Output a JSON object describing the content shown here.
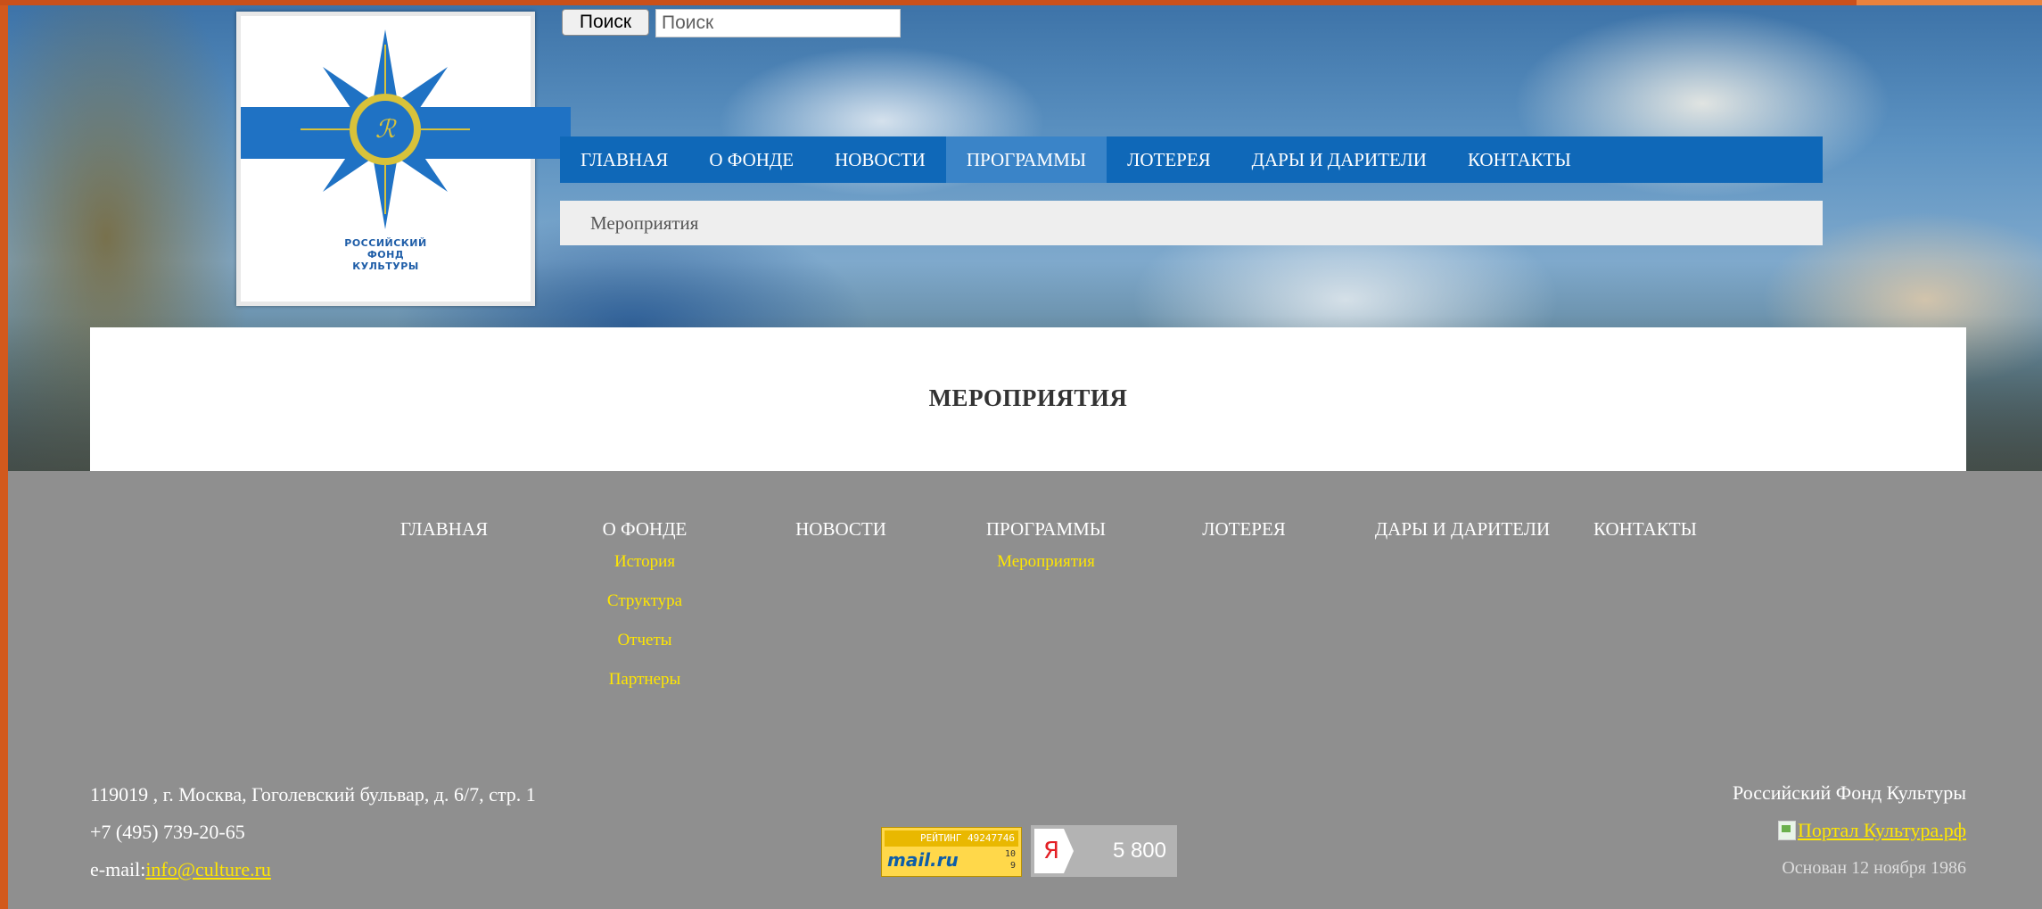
{
  "search": {
    "button_label": "Поиск",
    "placeholder": "Поиск"
  },
  "logo": {
    "lines": [
      "РОССИЙСКИЙ",
      "ФОНД",
      "КУЛЬТУРЫ"
    ]
  },
  "main_nav": [
    {
      "label": "ГЛАВНАЯ",
      "active": false
    },
    {
      "label": "О ФОНДЕ",
      "active": false
    },
    {
      "label": "НОВОСТИ",
      "active": false
    },
    {
      "label": "ПРОГРАММЫ",
      "active": true
    },
    {
      "label": "ЛОТЕРЕЯ",
      "active": false
    },
    {
      "label": "ДАРЫ И ДАРИТЕЛИ",
      "active": false
    },
    {
      "label": "КОНТАКТЫ",
      "active": false
    }
  ],
  "breadcrumb": "Мероприятия",
  "page_title": "МЕРОПРИЯТИЯ",
  "footer_nav": [
    {
      "label": "ГЛАВНАЯ",
      "sub": []
    },
    {
      "label": "О ФОНДЕ",
      "sub": [
        "История",
        "Структура",
        "Отчеты",
        "Партнеры"
      ]
    },
    {
      "label": "НОВОСТИ",
      "sub": []
    },
    {
      "label": "ПРОГРАММЫ",
      "sub": [
        "Мероприятия"
      ]
    },
    {
      "label": "ЛОТЕРЕЯ",
      "sub": []
    },
    {
      "label": "ДАРЫ И ДАРИТЕЛИ",
      "sub": []
    },
    {
      "label": "КОНТАКТЫ",
      "sub": []
    }
  ],
  "contacts": {
    "address": "119019 , г. Москва, Гоголевский бульвар, д. 6/7, стр. 1",
    "phone": "+7 (495) 739-20-65",
    "email_label": "e-mail:",
    "email": "info@culture.ru"
  },
  "counters": {
    "mail_top": "РЕЙТИНГ 49247746",
    "mail_brand": "mail.ru",
    "mail_num_1": "10",
    "mail_num_2": "9",
    "yandex_letter": "Я",
    "yandex_count": "5 800"
  },
  "org": {
    "name": "Российский Фонд Культуры",
    "portal_alt": "Портал Культура.рф",
    "founded": "Основан 12 ноября 1986"
  },
  "colors": {
    "nav_blue": "#0f68b8",
    "footer_gray": "#8f8f8f",
    "link_yellow": "#ffe600",
    "frame_orange": "#d2591d"
  }
}
